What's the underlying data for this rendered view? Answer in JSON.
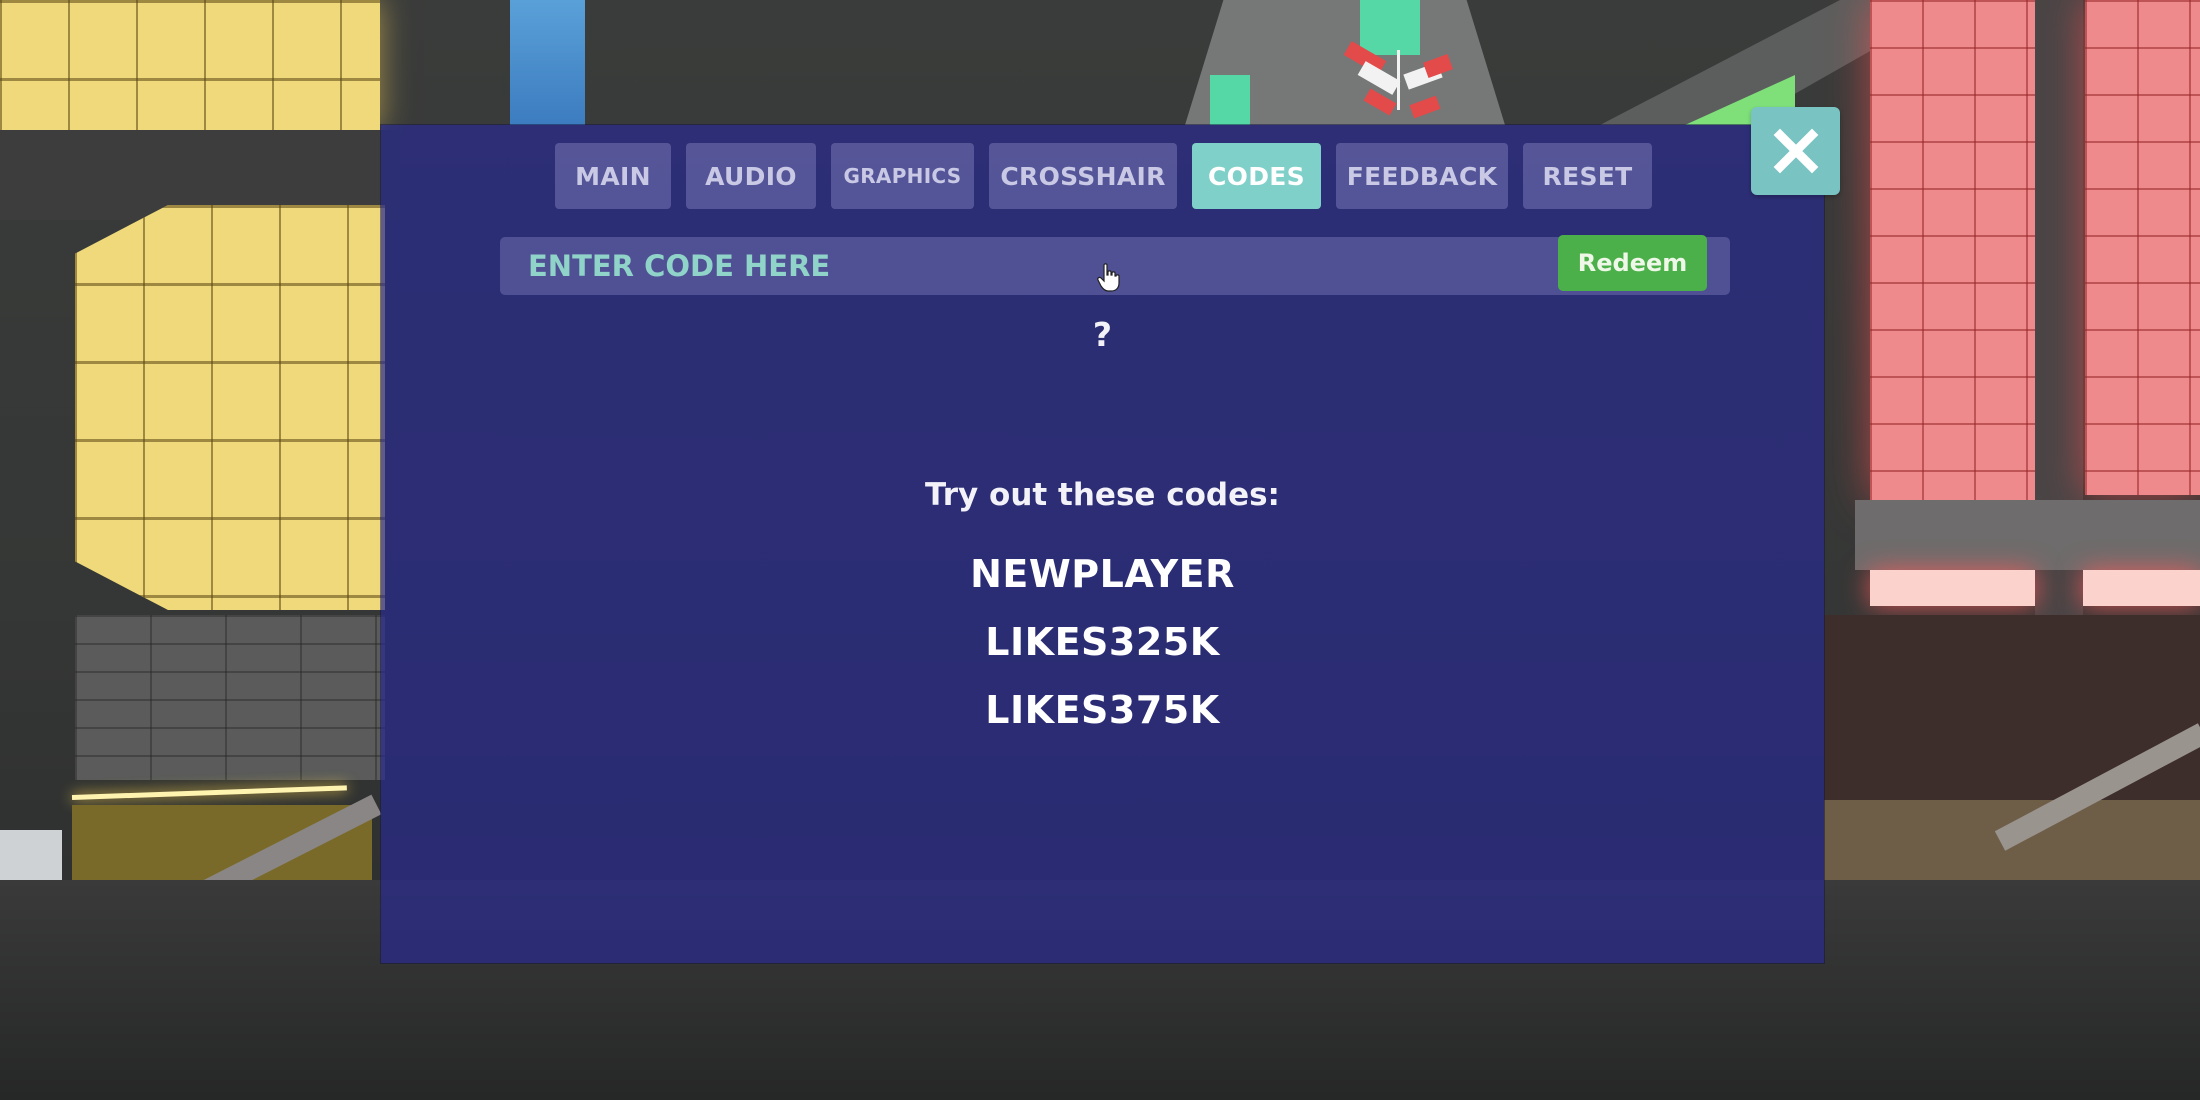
{
  "settings": {
    "tabs": [
      {
        "label": "MAIN",
        "active": false
      },
      {
        "label": "AUDIO",
        "active": false
      },
      {
        "label": "GRAPHICS",
        "active": false
      },
      {
        "label": "CROSSHAIR",
        "active": false
      },
      {
        "label": "CODES",
        "active": true
      },
      {
        "label": "FEEDBACK",
        "active": false
      },
      {
        "label": "RESET",
        "active": false
      }
    ],
    "close_icon": "close-x-icon"
  },
  "codes": {
    "input_placeholder": "ENTER CODE HERE",
    "input_value": "",
    "redeem_label": "Redeem",
    "status_symbol": "?",
    "hint_text": "Try out these codes:",
    "list": [
      "NEWPLAYER",
      "LIKES325K",
      "LIKES375K"
    ]
  },
  "colors": {
    "panel": "#28288C",
    "tab_inactive": "#8C8CC8",
    "tab_active": "#7FD0C8",
    "close_button": "#79C3C2",
    "redeem_button": "#4CB04A",
    "placeholder_text": "#8FD3C9"
  }
}
